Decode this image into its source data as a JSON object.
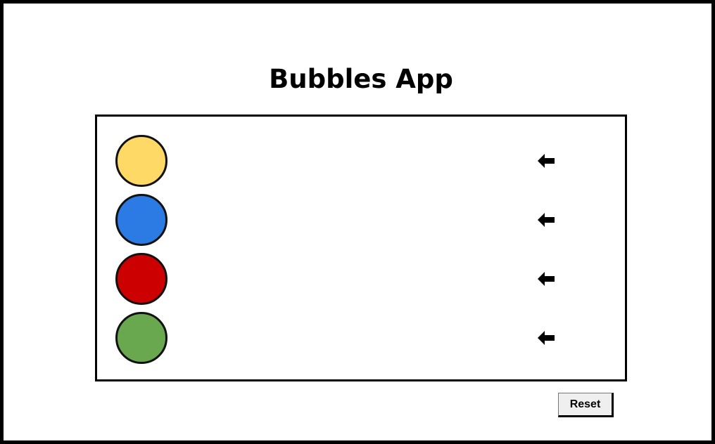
{
  "app": {
    "title": "Bubbles App"
  },
  "bubbles": [
    {
      "color_name": "yellow",
      "color": "#FFD966",
      "arrow_icon": "arrow-left-icon"
    },
    {
      "color_name": "blue",
      "color": "#2C7BE5",
      "arrow_icon": "arrow-left-icon"
    },
    {
      "color_name": "red",
      "color": "#CC0000",
      "arrow_icon": "arrow-left-icon"
    },
    {
      "color_name": "green",
      "color": "#6AA84F",
      "arrow_icon": "arrow-left-icon"
    }
  ],
  "controls": {
    "reset_label": "Reset"
  },
  "colors": {
    "border": "#000000",
    "background": "#FFFFFF",
    "button_background": "#EFEFEF"
  }
}
